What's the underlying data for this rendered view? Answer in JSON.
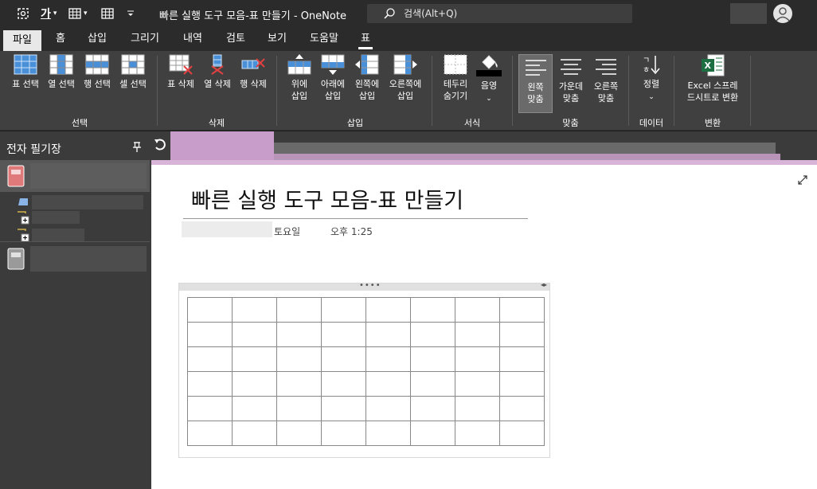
{
  "window": {
    "title": "빠른 실행 도구 모음-표 만들기  -  OneNote",
    "search_placeholder": "검색(Alt+Q)"
  },
  "qat": {
    "font_glyph": "가"
  },
  "tabs": [
    {
      "label": "파일",
      "active": true
    },
    {
      "label": "홈"
    },
    {
      "label": "삽입"
    },
    {
      "label": "그리기"
    },
    {
      "label": "내역"
    },
    {
      "label": "검토"
    },
    {
      "label": "보기"
    },
    {
      "label": "도움말"
    },
    {
      "label": "표",
      "current": true
    }
  ],
  "ribbon": {
    "groups": {
      "select": "선택",
      "delete": "삭제",
      "insert": "삽입",
      "format": "서식",
      "align": "맞춤",
      "data": "데이터",
      "convert": "변환"
    },
    "buttons": {
      "select_table": "표 선택",
      "select_column": "열 선택",
      "select_row": "행 선택",
      "select_cell": "셀 선택",
      "delete_table": "표 삭제",
      "delete_column": "열 삭제",
      "delete_row": "행 삭제",
      "insert_above_1": "위에",
      "insert_above_2": "삽입",
      "insert_below_1": "아래에",
      "insert_below_2": "삽입",
      "insert_left_1": "왼쪽에",
      "insert_left_2": "삽입",
      "insert_right_1": "오른쪽에",
      "insert_right_2": "삽입",
      "hide_borders_1": "테두리",
      "hide_borders_2": "숨기기",
      "shading": "음영",
      "align_left_1": "왼쪽",
      "align_left_2": "맞춤",
      "align_center_1": "가운데",
      "align_center_2": "맞춤",
      "align_right_1": "오른쪽",
      "align_right_2": "맞춤",
      "sort": "정렬",
      "convert_excel_1": "Excel 스프레",
      "convert_excel_2": "드시트로 변환"
    }
  },
  "left_pane": {
    "title": "전자 필기장"
  },
  "page": {
    "title": "빠른 실행 도구 모음-표 만들기",
    "day": "토요일",
    "time": "오후 1:25"
  },
  "table": {
    "rows": 6,
    "cols": 8
  },
  "colors": {
    "accent_purple": "#d8b4d8",
    "notebook_pink": "#e07a7a",
    "excel_green": "#1d6f42"
  }
}
